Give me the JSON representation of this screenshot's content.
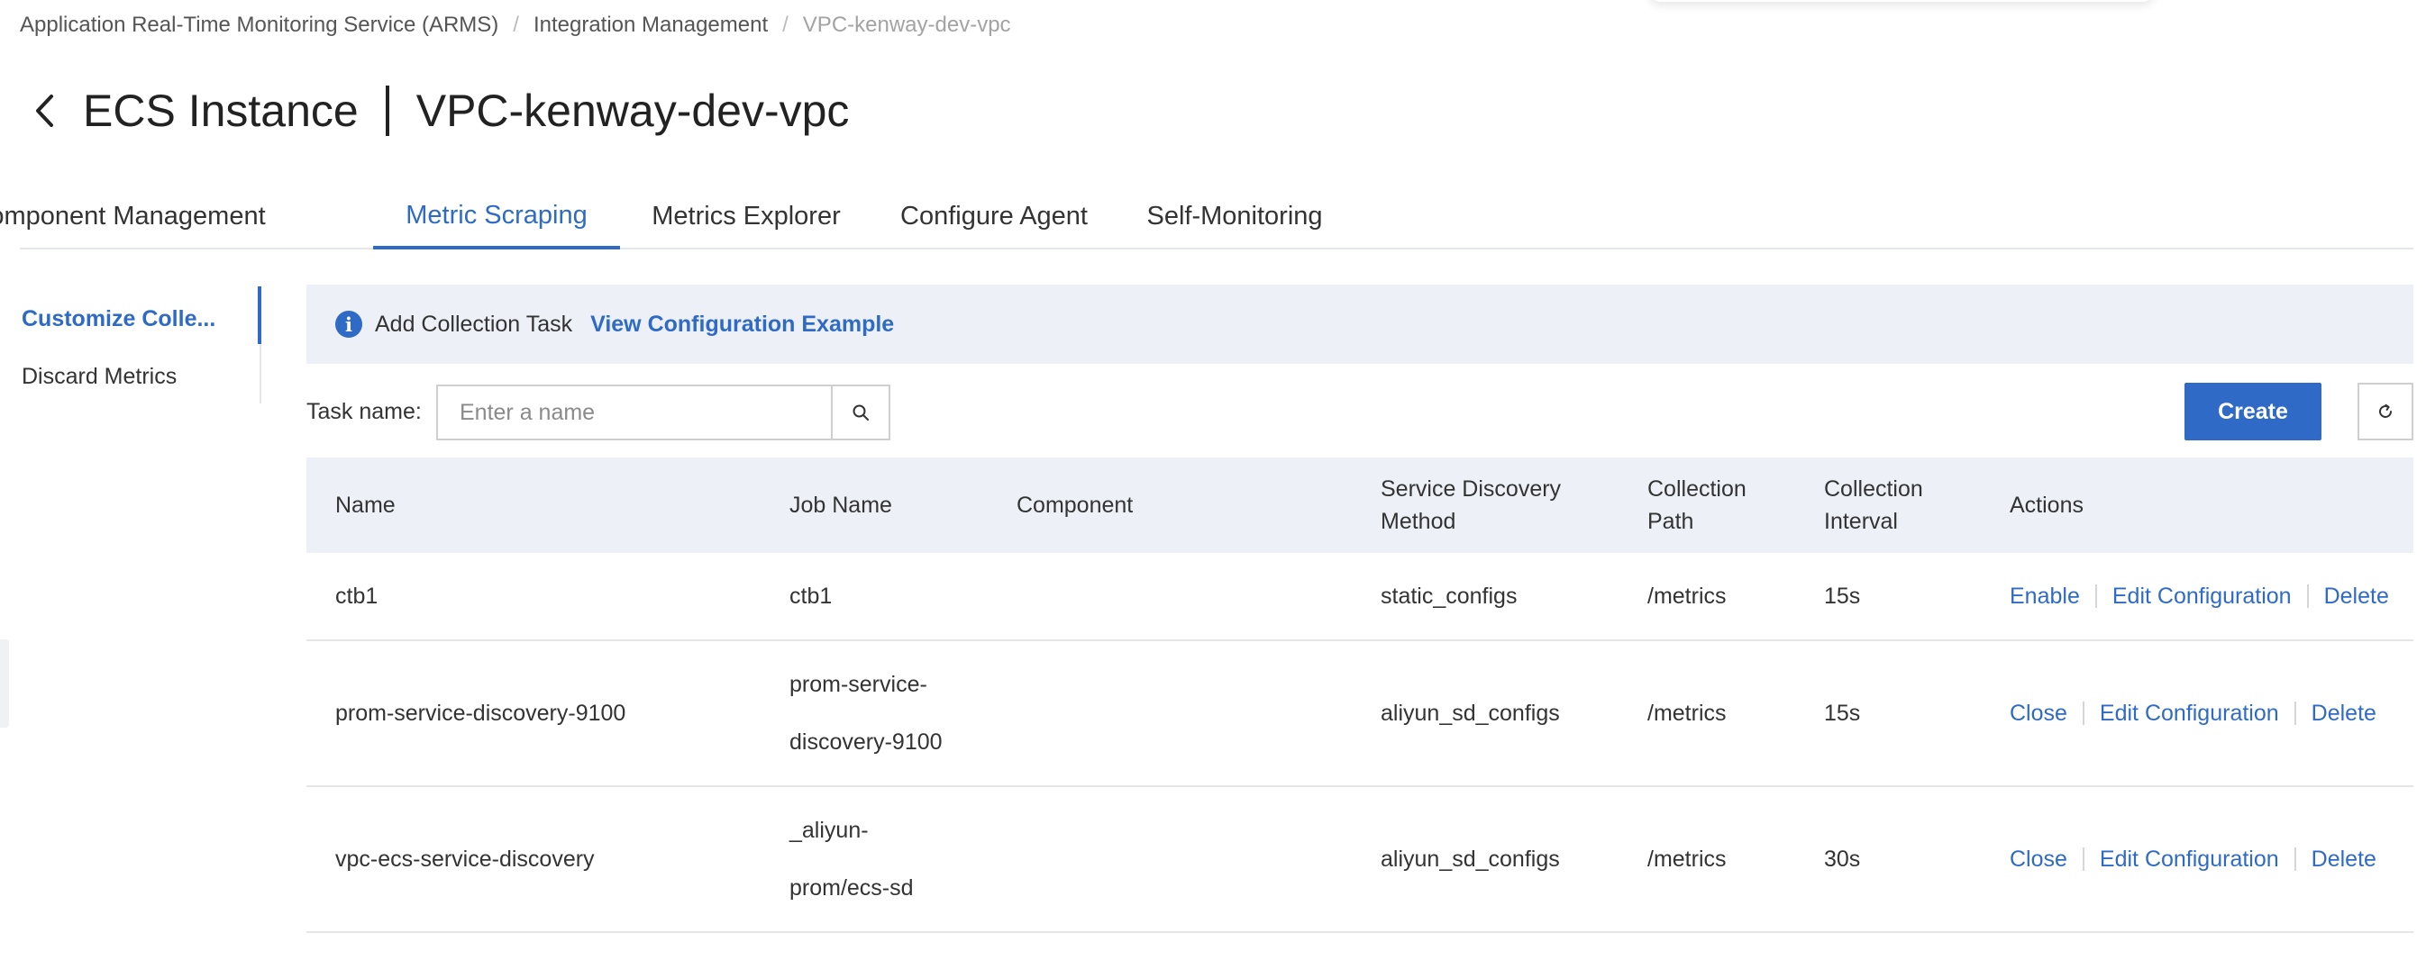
{
  "breadcrumb": {
    "items": [
      "Application Real-Time Monitoring Service (ARMS)",
      "Integration Management"
    ],
    "current": "VPC-kenway-dev-vpc"
  },
  "header": {
    "title": "ECS Instance",
    "subtitle": "VPC-kenway-dev-vpc"
  },
  "tabs": [
    {
      "label": "Component Management"
    },
    {
      "label": "Metric Scraping",
      "active": true
    },
    {
      "label": "Metrics Explorer"
    },
    {
      "label": "Configure Agent"
    },
    {
      "label": "Self-Monitoring"
    }
  ],
  "side_nav": {
    "items": [
      {
        "label": "Customize Colle...",
        "active": true
      },
      {
        "label": "Discard Metrics"
      }
    ]
  },
  "info_bar": {
    "text": "Add Collection Task",
    "link": "View Configuration Example"
  },
  "filter": {
    "label": "Task name:",
    "placeholder": "Enter a name"
  },
  "toolbar": {
    "create_label": "Create"
  },
  "table": {
    "columns": {
      "name": "Name",
      "job": "Job Name",
      "component": "Component",
      "sd_line1": "Service Discovery",
      "sd_line2": "Method",
      "path_line1": "Collection",
      "path_line2": "Path",
      "interval_line1": "Collection",
      "interval_line2": "Interval",
      "actions": "Actions"
    },
    "rows": [
      {
        "name": "ctb1",
        "job_lines": [
          "ctb1"
        ],
        "component": "",
        "sd": "static_configs",
        "path": "/metrics",
        "interval": "15s",
        "actions": [
          "Enable",
          "Edit Configuration",
          "Delete"
        ]
      },
      {
        "name": "prom-service-discovery-9100",
        "job_lines": [
          "prom-service-",
          "discovery-9100"
        ],
        "component": "",
        "sd": "aliyun_sd_configs",
        "path": "/metrics",
        "interval": "15s",
        "actions": [
          "Close",
          "Edit Configuration",
          "Delete"
        ]
      },
      {
        "name": "vpc-ecs-service-discovery",
        "job_lines": [
          "_aliyun-",
          "prom/ecs-sd"
        ],
        "component": "",
        "sd": "aliyun_sd_configs",
        "path": "/metrics",
        "interval": "30s",
        "actions": [
          "Close",
          "Edit Configuration",
          "Delete"
        ]
      }
    ]
  },
  "colors": {
    "accent": "#2f6bc6",
    "header_bg": "#edf1f7",
    "border": "#e6e6e6"
  },
  "icons": [
    "chevron-left-icon",
    "info-icon",
    "search-icon",
    "refresh-icon"
  ]
}
